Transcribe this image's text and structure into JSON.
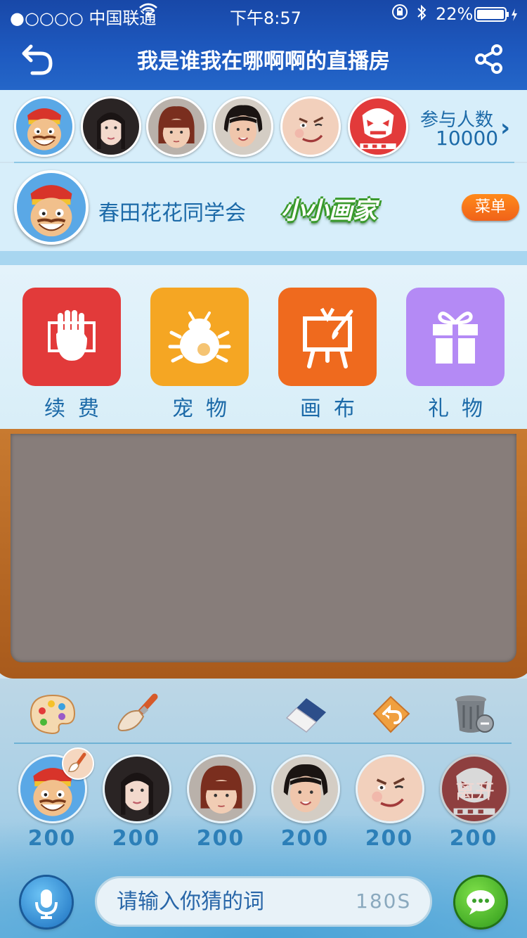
{
  "status_bar": {
    "carrier": "●○○○○ 中国联通",
    "time": "下午8:57",
    "battery": "22%"
  },
  "header": {
    "title": "我是谁我在哪啊啊的直播房",
    "back_icon": "back-arrow-icon",
    "share_icon": "share-icon"
  },
  "audience": {
    "count_label": "参与人数",
    "count_value": "10000",
    "avatars": [
      "cartoon-king-avatar",
      "woman-avatar",
      "child-avatar",
      "girl-avatar",
      "funny-face-avatar",
      "red-mask-avatar"
    ]
  },
  "host": {
    "name": "春田花花同学会",
    "badge": "小小画家",
    "menu_label": "菜单"
  },
  "menu_items": [
    {
      "label": "续费",
      "icon": "renew-hand-icon",
      "color": "#e23a3a"
    },
    {
      "label": "宠物",
      "icon": "pet-bug-icon",
      "color": "#f5a623"
    },
    {
      "label": "画布",
      "icon": "canvas-easel-icon",
      "color": "#ef6a1e"
    },
    {
      "label": "礼物",
      "icon": "gift-icon",
      "color": "#b48af5"
    }
  ],
  "tools": [
    "palette-icon",
    "brush-icon",
    "eraser-icon",
    "undo-icon",
    "trash-icon"
  ],
  "players": [
    {
      "score": "200",
      "avatar": "cartoon-king-avatar"
    },
    {
      "score": "200",
      "avatar": "woman-avatar"
    },
    {
      "score": "200",
      "avatar": "child-avatar"
    },
    {
      "score": "200",
      "avatar": "girl-avatar"
    },
    {
      "score": "200",
      "avatar": "funny-face-avatar"
    },
    {
      "score": "200",
      "avatar": "red-mask-avatar",
      "overlay_label": "离开"
    }
  ],
  "input": {
    "placeholder": "请输入你猜的词",
    "timer": "180S"
  }
}
